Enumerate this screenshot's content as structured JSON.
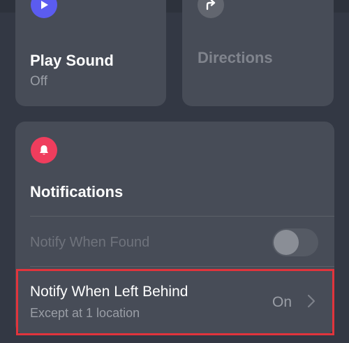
{
  "play_sound": {
    "title": "Play Sound",
    "status": "Off",
    "icon": "play-icon",
    "icon_color": "#5b5cf0"
  },
  "directions": {
    "title": "Directions",
    "icon": "directions-arrow-icon"
  },
  "notifications": {
    "title": "Notifications",
    "icon": "bell-icon",
    "icon_color": "#ef3d5d",
    "notify_when_found": {
      "label": "Notify When Found",
      "enabled": false
    },
    "notify_when_left_behind": {
      "label": "Notify When Left Behind",
      "detail": "Except at 1 location",
      "value": "On"
    }
  },
  "highlight_color": "#e1343c"
}
